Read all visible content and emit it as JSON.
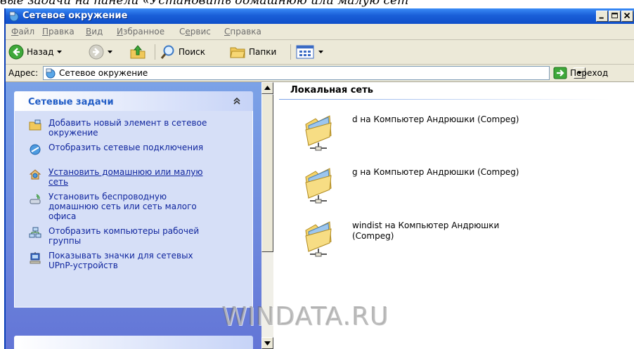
{
  "page_top_text": "вые задачи на панели «Установить домашнюю или малую сет",
  "window": {
    "title": "Сетевое окружение",
    "controls": [
      "minimize",
      "maximize",
      "close"
    ]
  },
  "menubar": {
    "items": [
      {
        "label": "Файл",
        "hotkey": "Ф"
      },
      {
        "label": "Правка",
        "hotkey": "П"
      },
      {
        "label": "Вид",
        "hotkey": "В"
      },
      {
        "label": "Избранное",
        "hotkey": "И"
      },
      {
        "label": "Сервис",
        "hotkey": "е"
      },
      {
        "label": "Справка",
        "hotkey": "С"
      }
    ]
  },
  "toolbar": {
    "back_label": "Назад",
    "search_label": "Поиск",
    "folders_label": "Папки"
  },
  "addressbar": {
    "label": "Адрес:",
    "value": "Сетевое окружение",
    "go_label": "Переход"
  },
  "sidebar": {
    "section_title": "Сетевые задачи",
    "tasks": [
      {
        "label": "Добавить новый элемент в сетевое окружение",
        "icon": "add-network-place-icon"
      },
      {
        "label": "Отобразить сетевые подключения",
        "icon": "network-connections-icon"
      },
      {
        "label": "Установить домашнюю или малую сеть",
        "icon": "home-network-icon",
        "hovered": true
      },
      {
        "label": "Установить беспроводную домашнюю сеть или сеть малого офиса",
        "icon": "wireless-network-icon"
      },
      {
        "label": "Отобразить компьютеры рабочей группы",
        "icon": "workgroup-computers-icon"
      },
      {
        "label": "Показывать значки для сетевых UPnP-устройств",
        "icon": "upnp-device-icon"
      }
    ]
  },
  "main": {
    "group_title": "Локальная сеть",
    "items": [
      {
        "label": "d на Компьютер Андрюшки (Compeg)",
        "icon": "network-share-folder-icon"
      },
      {
        "label": "g на Компьютер Андрюшки (Compeg)",
        "icon": "network-share-folder-icon"
      },
      {
        "label": "windist на Компьютер Андрюшки (Compeg)",
        "icon": "network-share-folder-icon"
      }
    ]
  },
  "watermark": "WINDATA.RU",
  "colors": {
    "titlebar": "#1a5fd8",
    "sidepanel": "#6f8fe0",
    "task_link": "#10269e",
    "section_title": "#215dc6"
  }
}
